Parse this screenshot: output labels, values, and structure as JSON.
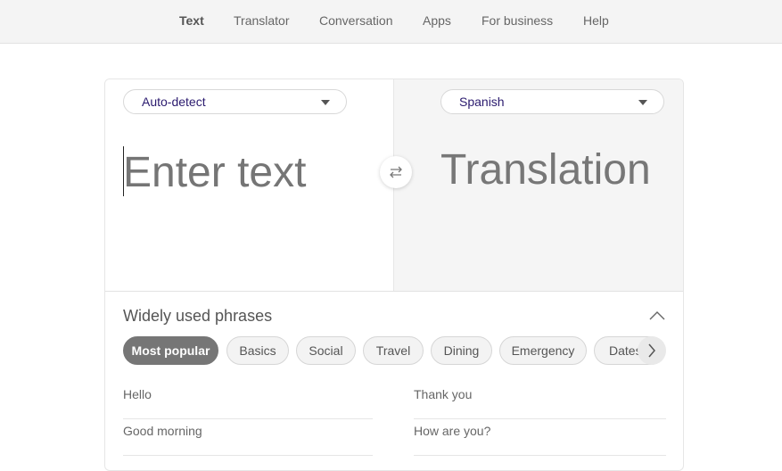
{
  "nav": {
    "items": [
      {
        "label": "Text",
        "active": true
      },
      {
        "label": "Translator",
        "active": false
      },
      {
        "label": "Conversation",
        "active": false
      },
      {
        "label": "Apps",
        "active": false
      },
      {
        "label": "For business",
        "active": false
      },
      {
        "label": "Help",
        "active": false
      }
    ]
  },
  "source": {
    "language": "Auto-detect",
    "placeholder": "Enter text",
    "value": ""
  },
  "target": {
    "language": "Spanish",
    "placeholder": "Translation"
  },
  "swap": {
    "icon": "swap-arrows-icon"
  },
  "phrases": {
    "title": "Widely used phrases",
    "collapse_icon": "chevron-up-icon",
    "categories": [
      {
        "label": "Most popular",
        "active": true
      },
      {
        "label": "Basics",
        "active": false
      },
      {
        "label": "Social",
        "active": false
      },
      {
        "label": "Travel",
        "active": false
      },
      {
        "label": "Dining",
        "active": false
      },
      {
        "label": "Emergency",
        "active": false
      },
      {
        "label": "Dates",
        "active": false
      }
    ],
    "next_icon": "chevron-right-icon",
    "items": [
      "Hello",
      "Thank you",
      "Good morning",
      "How are you?"
    ]
  },
  "colors": {
    "accent_language": "#2a1a6e",
    "active_chip": "#767676",
    "nav_background": "#f4f4f4",
    "translation_pane": "#f5f5f5"
  }
}
